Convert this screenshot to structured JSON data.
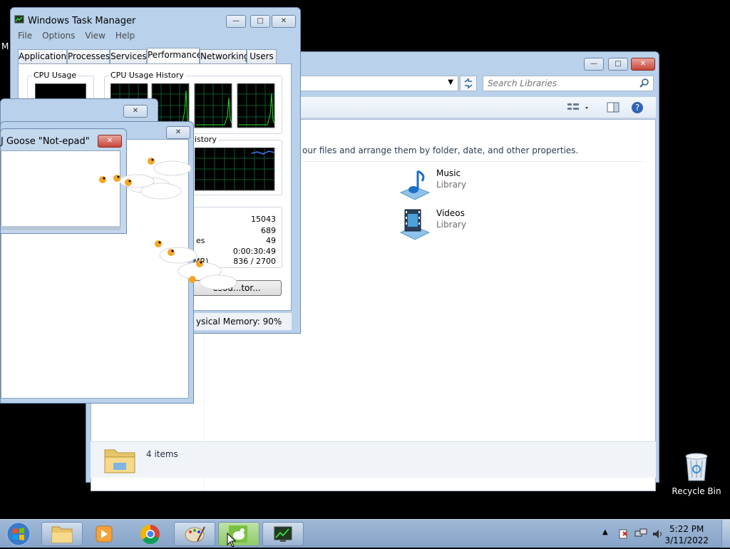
{
  "explorer": {
    "search_placeholder": "Search Libraries",
    "description": "our files and arrange them by folder, date, and other properties.",
    "libraries": [
      {
        "name": "Music",
        "sub": "Library"
      },
      {
        "name": "Videos",
        "sub": "Library"
      }
    ],
    "item_count": "4 items"
  },
  "taskmgr": {
    "title": "Windows Task Manager",
    "menu": [
      "File",
      "Options",
      "View",
      "Help"
    ],
    "tabs": [
      "Applications",
      "Processes",
      "Services",
      "Performance",
      "Networking",
      "Users"
    ],
    "active_tab": "Performance",
    "cpu_usage_label": "CPU Usage",
    "cpu_history_label": "CPU Usage History",
    "mem_history_label": "istory",
    "stats": [
      "15043",
      "689",
      "49",
      "0:00:30:49",
      "836 / 2700"
    ],
    "stat_label_es": "es",
    "stat_label_mr": "MR)",
    "resource_btn": "esou...tor...",
    "status_memory": "ysical Memory: 90%"
  },
  "notepad": {
    "goose_title": "J Goose \"Not-epad\""
  },
  "desktop": {
    "edge_letter": "M",
    "recycle_bin": "Recycle Bin"
  },
  "taskbar": {
    "time": "5:22 PM",
    "date": "3/11/2022"
  },
  "colors": {
    "frame": "#b9d1ea",
    "graph_line": "#1ee31e",
    "taskbar": "#9fb8d6"
  }
}
